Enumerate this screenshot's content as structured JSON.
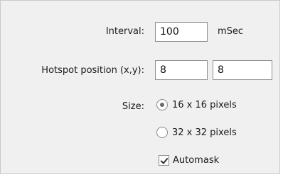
{
  "interval": {
    "label": "Interval:",
    "value": "100",
    "unit": "mSec"
  },
  "hotspot": {
    "label": "Hotspot position (x,y):",
    "x_value": "8",
    "y_value": "8"
  },
  "size": {
    "label": "Size:",
    "options": [
      {
        "label": "16 x 16 pixels",
        "selected": true
      },
      {
        "label": "32 x 32 pixels",
        "selected": false
      }
    ]
  },
  "automask": {
    "label": "Automask",
    "checked": true
  }
}
